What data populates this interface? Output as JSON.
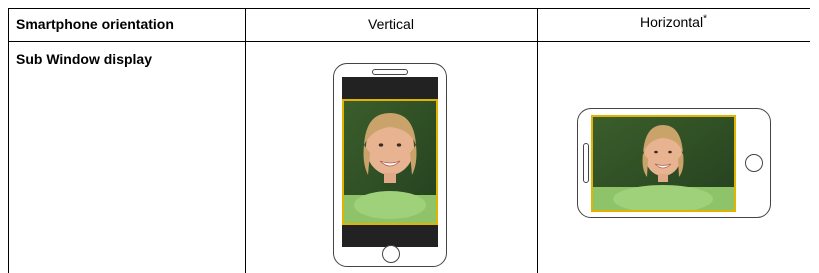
{
  "table": {
    "header": {
      "row_label": "Smartphone orientation",
      "col_vertical": "Vertical",
      "col_horizontal": "Horizontal",
      "col_horizontal_mark": "*"
    },
    "row": {
      "label": "Sub Window display"
    }
  },
  "illustrations": {
    "vertical_phone": {
      "icon": "phone-portrait-icon"
    },
    "horizontal_phone": {
      "icon": "phone-landscape-icon"
    },
    "photo": {
      "icon": "smiling-person-photo"
    }
  },
  "colors": {
    "frame_accent": "#e0b400",
    "screen_dark": "#222222"
  }
}
